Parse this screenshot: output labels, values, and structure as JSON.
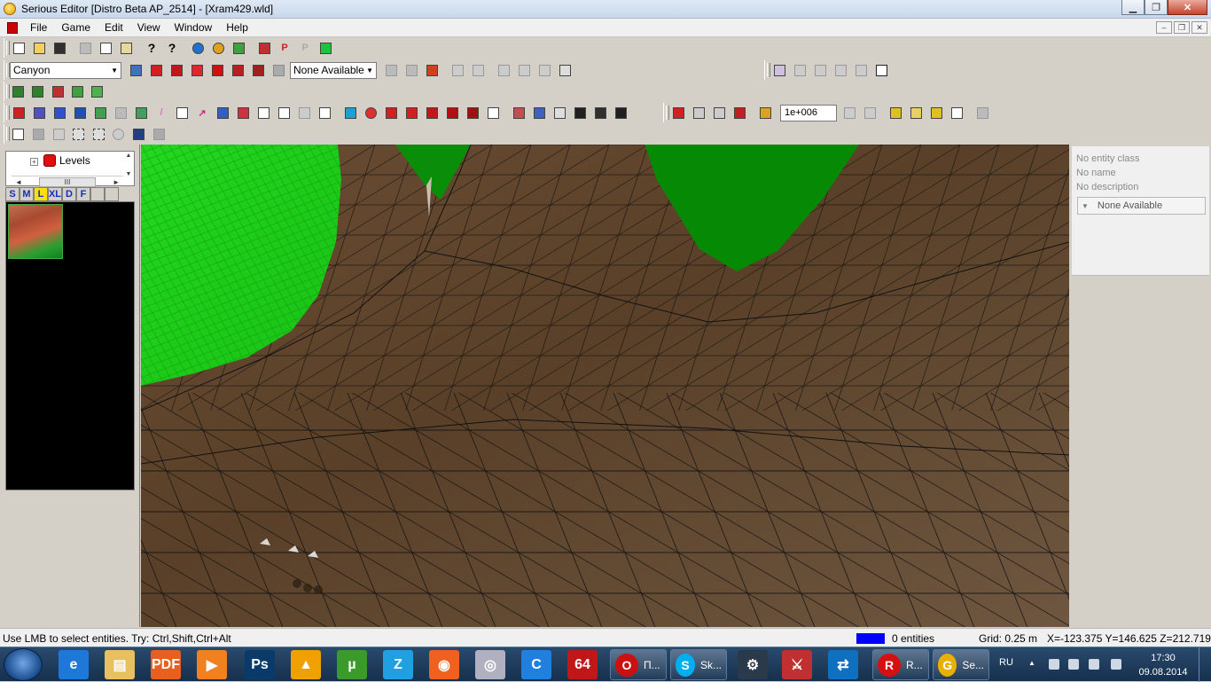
{
  "window": {
    "title": "Serious Editor [Distro Beta AP_2514] - [Xram429.wld]"
  },
  "window_controls": {
    "minimize": "▁",
    "maximize": "❐",
    "close": "✕"
  },
  "mdi_controls": {
    "minimize": "–",
    "restore": "❐",
    "close": "✕"
  },
  "menu": {
    "items": [
      "File",
      "Game",
      "Edit",
      "View",
      "Window",
      "Help"
    ]
  },
  "toolbar": {
    "world_dropdown": "Canyon",
    "none_available_dropdown": "None Available",
    "snap_value": "1e+006",
    "dropdown_arrow": "▼"
  },
  "left_panel": {
    "tree_label": "Levels",
    "tree_expander": "+",
    "scroll_left": "◄",
    "scroll_right": "►",
    "scroll_thumb": "III",
    "scroll_up": "▲",
    "scroll_down": "▼",
    "size_buttons": [
      "S",
      "M",
      "L",
      "XL",
      "D",
      "F",
      "",
      ""
    ],
    "selected_size": "L"
  },
  "properties": {
    "entity_class": "No entity class",
    "name": "No name",
    "description": "No description",
    "dropdown": "None Available",
    "dropdown_arrow": "▼"
  },
  "status": {
    "hint": "Use LMB to select entities. Try: Ctrl,Shift,Ctrl+Alt",
    "entities": "0 entities",
    "grid": "Grid: 0.25 m",
    "coords": "X=-123.375 Y=146.625 Z=212.719",
    "swatch_color": "#0000ff"
  },
  "taskbar": {
    "windows": [
      {
        "label": "П...",
        "icon": "opera-icon",
        "badge": "O",
        "color": "#cc1010"
      },
      {
        "label": "Sk...",
        "icon": "skype-icon",
        "badge": "S",
        "color": "#00aff0"
      },
      {
        "label": "R...",
        "icon": "r-app-icon",
        "badge": "R",
        "color": "#d41010"
      },
      {
        "label": "Se...",
        "icon": "serious-editor-icon",
        "badge": "G",
        "color": "#e8b000"
      }
    ],
    "pinned": [
      {
        "icon": "ie-icon",
        "glyph": "e",
        "color": "#1e78d8"
      },
      {
        "icon": "explorer-icon",
        "glyph": "▤",
        "color": "#e8c060"
      },
      {
        "icon": "pdf-icon",
        "glyph": "PDF",
        "color": "#e86020"
      },
      {
        "icon": "media-player-icon",
        "glyph": "▶",
        "color": "#f08020"
      },
      {
        "icon": "photoshop-icon",
        "glyph": "Ps",
        "color": "#0a3a6a"
      },
      {
        "icon": "aimp-icon",
        "glyph": "▲",
        "color": "#f0a000"
      },
      {
        "icon": "utorrent-icon",
        "glyph": "µ",
        "color": "#3a9a2a"
      },
      {
        "icon": "zona-icon",
        "glyph": "Z",
        "color": "#20a0e0"
      },
      {
        "icon": "origin-icon",
        "glyph": "◉",
        "color": "#f06020"
      },
      {
        "icon": "disc-icon",
        "glyph": "◎",
        "color": "#b0b0c0"
      },
      {
        "icon": "browser-icon",
        "glyph": "C",
        "color": "#2080e0"
      },
      {
        "icon": "app-64-icon",
        "glyph": "64",
        "color": "#c01818"
      }
    ],
    "pinned_right": [
      {
        "icon": "steam-icon",
        "glyph": "⚙",
        "color": "#2a3a4a"
      },
      {
        "icon": "game-icon",
        "glyph": "⚔",
        "color": "#c03030"
      },
      {
        "icon": "teamviewer-icon",
        "glyph": "⇄",
        "color": "#1070c0"
      }
    ]
  },
  "tray": {
    "lang": "RU",
    "time": "17:30",
    "date": "09.08.2014",
    "arrow": "▲"
  }
}
